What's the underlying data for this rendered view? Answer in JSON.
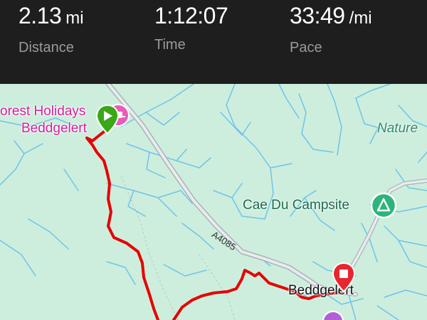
{
  "stats": {
    "distance": {
      "value": "2.13",
      "unit": "mi",
      "label": "Distance"
    },
    "time": {
      "value": "1:12:07",
      "label": "Time"
    },
    "pace": {
      "value": "33:49",
      "unit": "/mi",
      "label": "Pace"
    }
  },
  "map": {
    "poi_forest_holidays_line1": "orest Holidays",
    "poi_forest_holidays_line2": "Beddgelert",
    "poi_campsite": "Cae Du Campsite",
    "poi_nature": "Nature",
    "town": "Beddgelert",
    "road": "A4085"
  },
  "colors": {
    "route": "#e60000",
    "start_marker": "#3aa717",
    "end_marker": "#e8262f",
    "pink_poi": "#d61f9b",
    "campsite_marker": "#2bb57c",
    "map_background": "#cdeedd",
    "water": "#6fc3ea"
  },
  "icons": {
    "start": "play-icon",
    "end": "stop-icon",
    "holiday_park": "caravan-icon",
    "campsite": "tent-icon"
  }
}
